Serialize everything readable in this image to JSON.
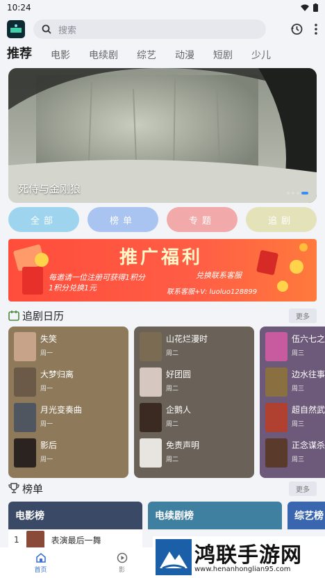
{
  "status_bar": {
    "time": "10:24"
  },
  "search": {
    "placeholder": "搜索"
  },
  "tabs": [
    {
      "label": "推荐"
    },
    {
      "label": "电影"
    },
    {
      "label": "电续剧"
    },
    {
      "label": "综艺"
    },
    {
      "label": "动漫"
    },
    {
      "label": "短剧"
    },
    {
      "label": "少儿"
    }
  ],
  "banner": {
    "title": "死侍与金刚狼"
  },
  "quick_pills": [
    {
      "label": "全部",
      "color": "#9fd4ef"
    },
    {
      "label": "榜单",
      "color": "#a9c4f0"
    },
    {
      "label": "专题",
      "color": "#f2a9a9"
    },
    {
      "label": "追剧",
      "color": "#e4e2b8"
    }
  ],
  "promo": {
    "title": "推广福利",
    "line1": "每邀请一位注册可获得1积分",
    "line2": "1积分兑换1元",
    "right1": "兑换联系客服",
    "right2": "联系客服+V: luoluo128899"
  },
  "calendar": {
    "title": "追剧日历",
    "more": "更多",
    "cards": [
      {
        "color": "#8e7a5a",
        "items": [
          {
            "name": "失笑",
            "day": "周一",
            "poster": "#c7a38a"
          },
          {
            "name": "大梦归离",
            "day": "周一",
            "poster": "#6b5a48"
          },
          {
            "name": "月光变奏曲",
            "day": "周一",
            "poster": "#4f5660"
          },
          {
            "name": "影后",
            "day": "周一",
            "poster": "#2a2320"
          }
        ]
      },
      {
        "color": "#6a6258",
        "items": [
          {
            "name": "山花烂漫时",
            "day": "周二",
            "poster": "#7a6b52"
          },
          {
            "name": "好团圆",
            "day": "周二",
            "poster": "#d6c8c0"
          },
          {
            "name": "企鹅人",
            "day": "周二",
            "poster": "#3a2a22"
          },
          {
            "name": "免责声明",
            "day": "周二",
            "poster": "#e8e4e0"
          }
        ]
      },
      {
        "color": "#6d5a7a",
        "items": [
          {
            "name": "伍六七之",
            "day": "周三",
            "poster": "#c85aa0"
          },
          {
            "name": "边水往事",
            "day": "周三",
            "poster": "#8a7040"
          },
          {
            "name": "超自然武",
            "day": "周三",
            "poster": "#b04030"
          },
          {
            "name": "正念谋杀",
            "day": "周三",
            "poster": "#5a3a2a"
          }
        ]
      }
    ]
  },
  "rankings": {
    "title": "榜单",
    "more": "更多",
    "cards": [
      {
        "label": "电影榜",
        "color": "#3a4a66"
      },
      {
        "label": "电续剧榜",
        "color": "#3f7fa0"
      },
      {
        "label": "综艺榜",
        "color": "#3a66b0"
      }
    ],
    "first_item": {
      "rank": "1",
      "name": "表演最后一舞"
    }
  },
  "bottom_nav": [
    {
      "label": "首页"
    },
    {
      "label": "影"
    }
  ],
  "watermark": {
    "title": "鸿联手游网",
    "url": "www.henanhonglian95.com"
  }
}
